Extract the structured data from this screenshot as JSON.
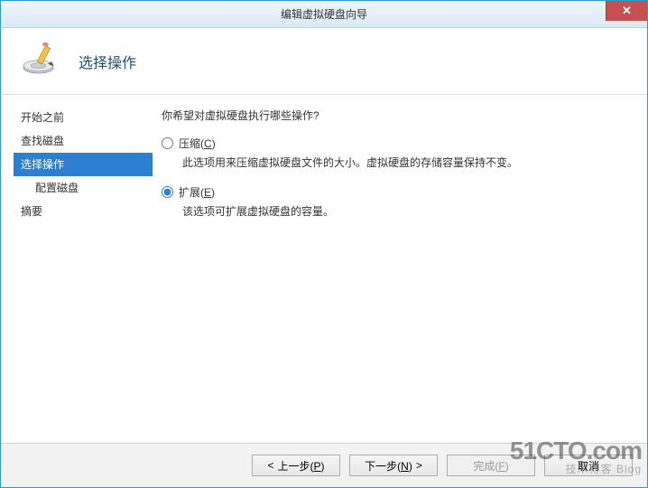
{
  "window": {
    "title": "编辑虚拟硬盘向导",
    "close_glyph": "✕"
  },
  "header": {
    "title": "选择操作"
  },
  "sidebar": {
    "items": [
      {
        "label": "开始之前"
      },
      {
        "label": "查找磁盘"
      },
      {
        "label": "选择操作"
      },
      {
        "label": "配置磁盘"
      },
      {
        "label": "摘要"
      }
    ]
  },
  "content": {
    "prompt": "你希望对虚拟硬盘执行哪些操作?",
    "options": [
      {
        "label_pre": "压缩",
        "access": "C",
        "label_post": ")",
        "paren_open": "(",
        "desc": "此选项用来压缩虚拟硬盘文件的大小。虚拟硬盘的存储容量保持不变。",
        "checked": false
      },
      {
        "label_pre": "扩展",
        "access": "E",
        "label_post": ")",
        "paren_open": "(",
        "desc": "该选项可扩展虚拟硬盘的容量。",
        "checked": true
      }
    ]
  },
  "footer": {
    "prev": {
      "arrow": "<",
      "text": "上一步",
      "access": "P",
      "close": ")"
    },
    "next": {
      "text": "下一步",
      "access": "N",
      "close": ")",
      "arrow": ">"
    },
    "finish": {
      "text": "完成",
      "access": "F",
      "close": ")"
    },
    "cancel": "取消"
  },
  "watermark": {
    "line1": "51CTO.com",
    "line2": "技术博客 Blog"
  }
}
